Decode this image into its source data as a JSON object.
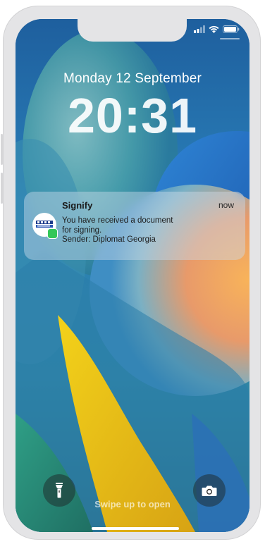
{
  "lockscreen": {
    "date": "Monday 12 September",
    "time": "20:31",
    "swipe_hint": "Swipe up to open"
  },
  "notification": {
    "app_name": "Signify",
    "time": "now",
    "message_lines": [
      "You have received a document",
      "for signing.",
      "Sender: Diplomat Georgia"
    ],
    "icon": "signify-logo"
  },
  "controls": {
    "flashlight_icon": "flashlight-icon",
    "camera_icon": "camera-icon"
  },
  "status_bar": {
    "icons": [
      "signal-icon",
      "wifi-icon",
      "battery-icon"
    ]
  },
  "colors": {
    "wallpaper_blue": "#1f6aa6",
    "wallpaper_orange": "#f2a25a",
    "wallpaper_yellow": "#e9c214",
    "badge_green": "#34c759"
  }
}
